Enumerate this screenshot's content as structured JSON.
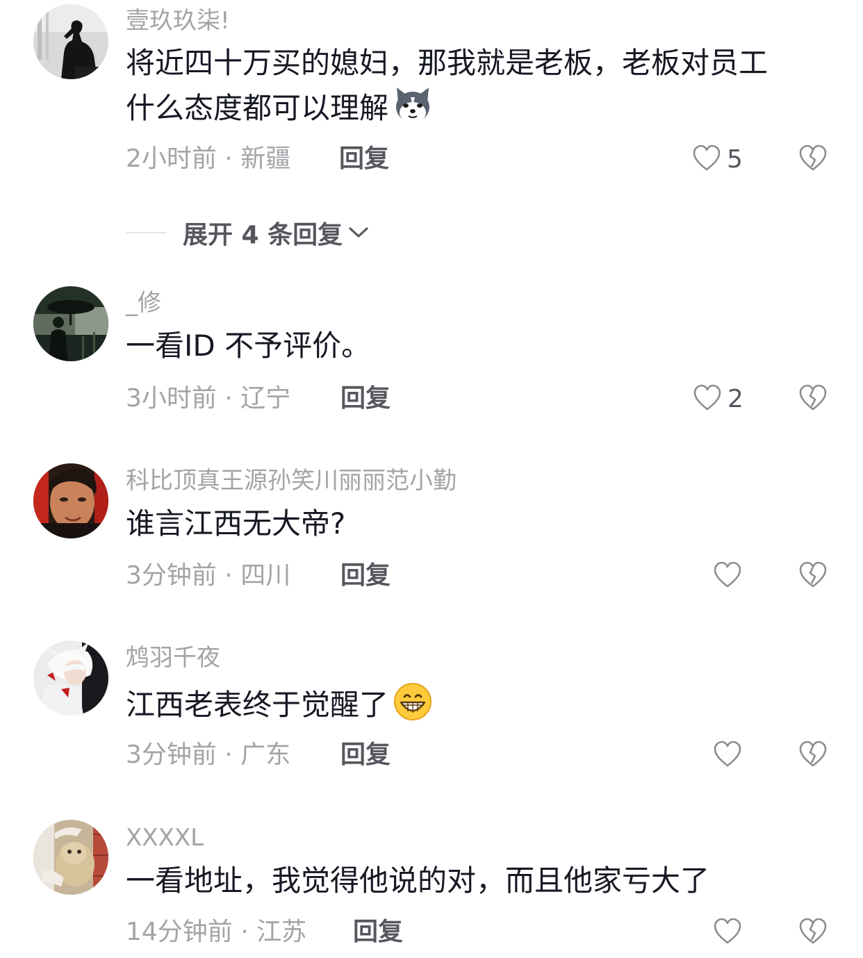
{
  "comments": [
    {
      "username": "壹玖玖柒!",
      "text_line1": "将近四十万买的媳妇，那我就是老板，老板对员工",
      "text_line2": "什么态度都可以理解",
      "emoji": "husky-dog-emoji",
      "time_location": "2小时前 · 新疆",
      "reply_label": "回复",
      "like_count": "5"
    },
    {
      "username": "_修",
      "text_line1": "一看ID 不予评价。",
      "time_location": "3小时前 · 辽宁",
      "reply_label": "回复",
      "like_count": "2"
    },
    {
      "username": "科比顶真王源孙笑川丽丽范小勤",
      "text_line1": "谁言江西无大帝?",
      "time_location": "3分钟前 · 四川",
      "reply_label": "回复",
      "like_count": ""
    },
    {
      "username": "鸩羽千夜",
      "text_line1": "江西老表终于觉醒了",
      "emoji": "grin-emoji",
      "time_location": "3分钟前 · 广东",
      "reply_label": "回复",
      "like_count": ""
    },
    {
      "username": "XXXXL",
      "text_line1": "一看地址，我觉得他说的对，而且他家亏大了",
      "time_location": "14分钟前 · 江苏",
      "reply_label": "回复",
      "like_count": ""
    }
  ],
  "expand_replies": {
    "label": "展开 4 条回复"
  },
  "icons": {
    "like": "heart-outline-icon",
    "dislike": "broken-heart-icon",
    "expand": "chevron-down-icon"
  },
  "colors": {
    "text": "#161823",
    "secondary": "#a3a3a8",
    "action": "#56575e"
  }
}
